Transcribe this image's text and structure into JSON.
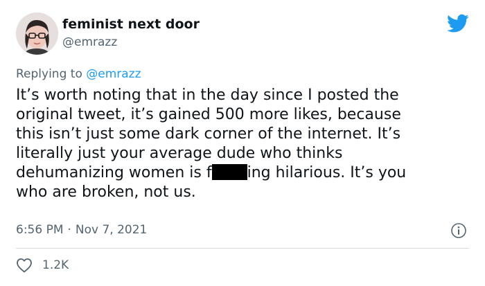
{
  "author": {
    "name": "feminist next door",
    "handle": "@emrazz"
  },
  "reply": {
    "prefix": "Replying to ",
    "handle": "@emrazz"
  },
  "tweet": {
    "line1": "It’s worth noting that in the day since I posted the",
    "line2": "original tweet, it’s gained 500 more likes, because",
    "line3": "this isn’t just some dark corner of the internet. It’s",
    "line4": "literally just your average dude who thinks",
    "line5a": "dehumanizing women is f",
    "line5b": "ing hilarious. It’s you",
    "line6": "who are broken, not us."
  },
  "meta": {
    "time": "6:56 PM",
    "separator": "·",
    "date": "Nov 7, 2021"
  },
  "stats": {
    "likes": "1.2K"
  },
  "colors": {
    "brand": "#1d9bf0",
    "text": "#0f1419",
    "secondary": "#536471",
    "divider": "#d7dbdf"
  },
  "icons": {
    "logo": "twitter-bird-icon",
    "info": "info-icon",
    "like": "heart-icon"
  }
}
